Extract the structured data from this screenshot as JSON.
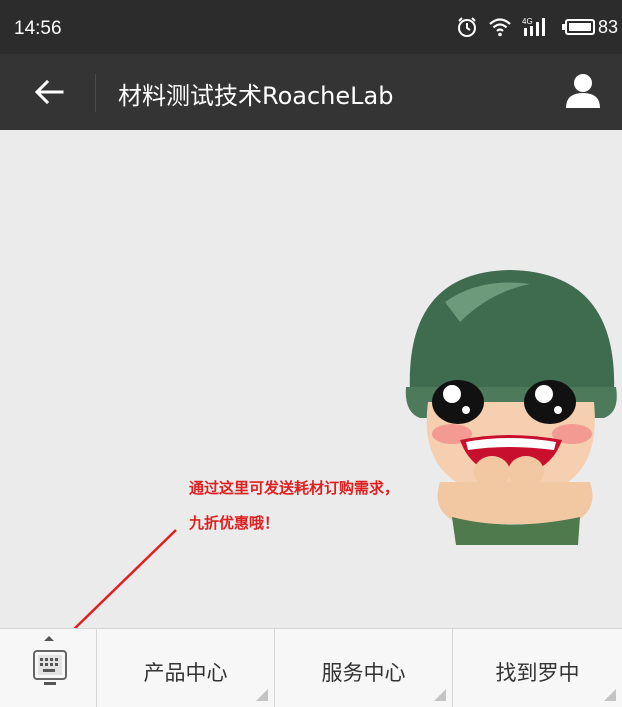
{
  "status_bar": {
    "time": "14:56",
    "network_label": "4G",
    "battery_level": "83",
    "icons": [
      "alarm-icon",
      "wifi-icon",
      "signal-icon",
      "battery-icon"
    ]
  },
  "header": {
    "title": "材料测试技术RoacheLab",
    "back_icon": "arrow-left-icon",
    "profile_icon": "person-icon"
  },
  "annotation": {
    "line1": "通过这里可发送耗材订购需求，",
    "line2": "九折优惠哦！",
    "color": "#e02020"
  },
  "bottom_menu": {
    "keyboard_icon": "keyboard-icon",
    "items": [
      {
        "label": "产品中心"
      },
      {
        "label": "服务中心"
      },
      {
        "label": "找到罗中"
      }
    ]
  },
  "colors": {
    "status_bar": "#2c2c2c",
    "title_bar": "#343434",
    "background": "#ebebeb",
    "menu_bg": "#f7f7f7"
  }
}
